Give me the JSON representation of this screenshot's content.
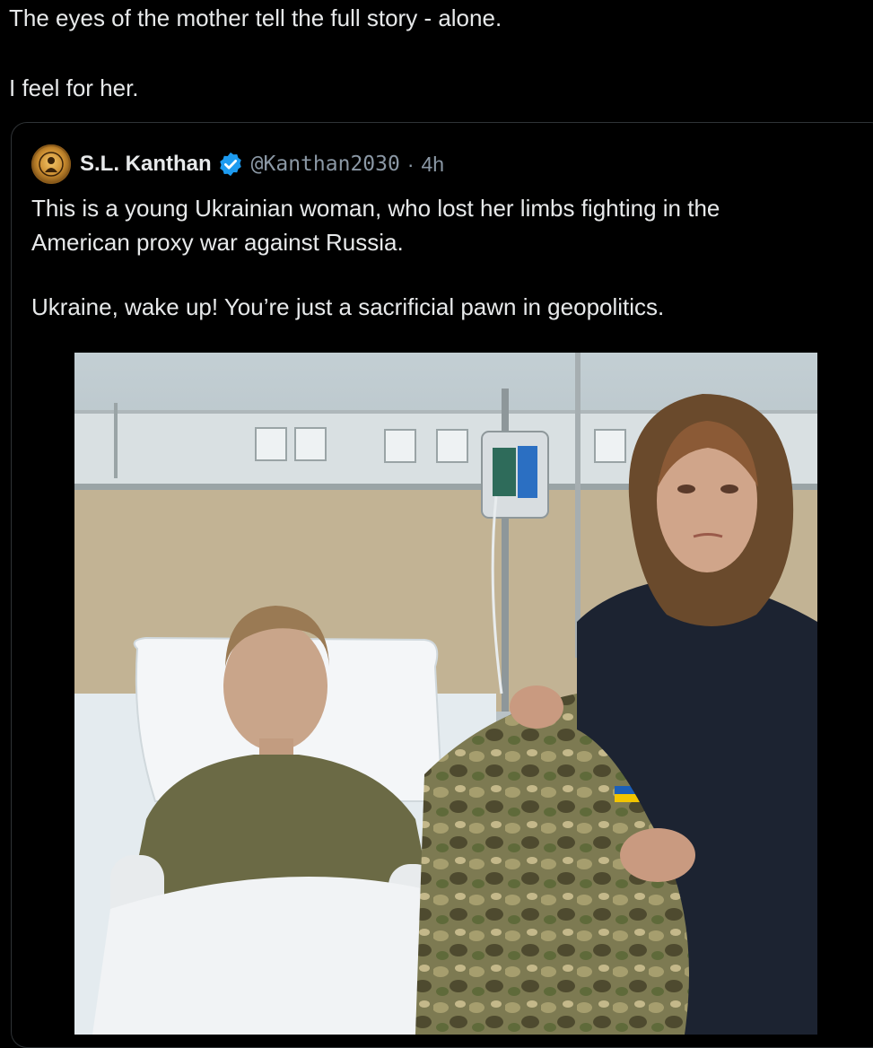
{
  "post": {
    "lines": [
      "The eyes of the mother tell the full story - alone.",
      "I feel for her."
    ]
  },
  "quote": {
    "display_name": "S.L. Kanthan",
    "handle": "@Kanthan2030",
    "separator": "·",
    "time": "4h",
    "lines": [
      "This is a young Ukrainian woman, who lost her limbs fighting in the",
      "American proxy war against Russia.",
      "Ukraine, wake up! You’re just a sacrificial pawn in geopolitics."
    ]
  },
  "icons": {
    "avatar": "avatar-emblem-icon",
    "verified": "verified-badge-icon"
  },
  "colors": {
    "background": "#000000",
    "text": "#e7e9ea",
    "secondary": "#8b98a5",
    "verified_blue": "#1d9bf0",
    "border": "#2f3336"
  }
}
